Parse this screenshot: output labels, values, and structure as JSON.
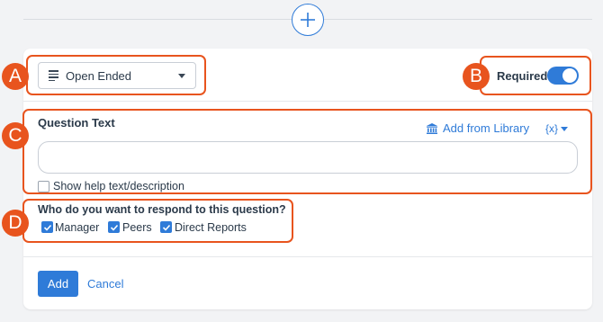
{
  "question_type": {
    "selected": "Open Ended",
    "icon": "align-left-icon"
  },
  "required": {
    "label": "Required",
    "enabled": true
  },
  "question_text": {
    "label": "Question Text",
    "value": "",
    "add_from_library": "Add from Library",
    "variable_menu": "{x}",
    "show_help_label": "Show help text/description",
    "show_help_checked": false
  },
  "responders": {
    "question": "Who do you want to respond to this question?",
    "options": [
      {
        "label": "Manager",
        "checked": true
      },
      {
        "label": "Peers",
        "checked": true
      },
      {
        "label": "Direct Reports",
        "checked": true
      }
    ]
  },
  "callouts": [
    "A",
    "B",
    "C",
    "D"
  ],
  "actions": {
    "add_label": "Add",
    "cancel_label": "Cancel"
  },
  "colors": {
    "accent": "#2f7bd8",
    "callout": "#e8541e"
  }
}
